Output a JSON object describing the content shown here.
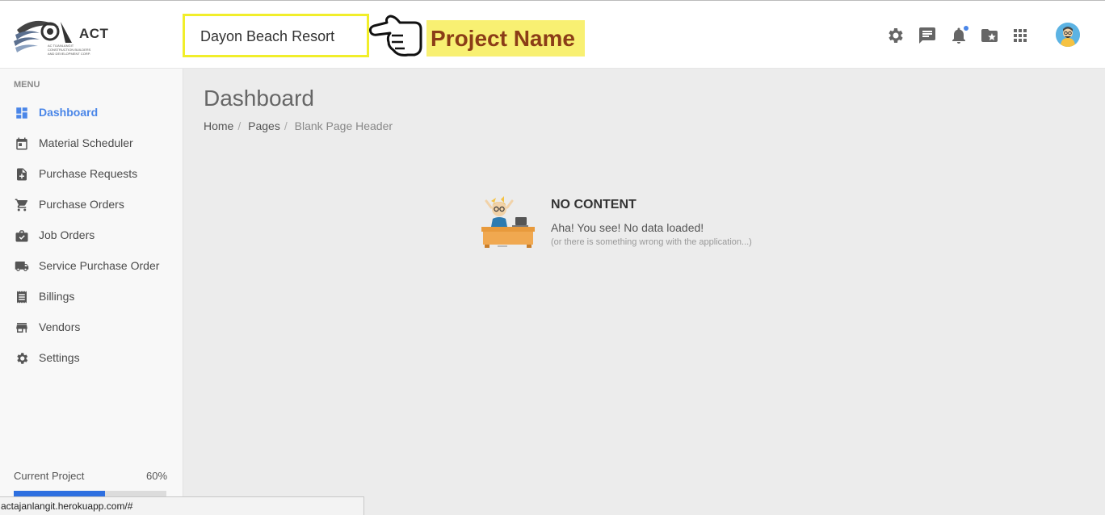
{
  "header": {
    "logo_text": "ACT",
    "logo_subtext": "AC TIJANLANGIT CONSTRUCTION BUILDERS AND DEVELOPMENT CORP.",
    "project_name": "Dayon Beach Resort",
    "annotation_label": "Project Name",
    "icons": [
      "gear-icon",
      "chat-icon",
      "bell-icon",
      "folder-star-icon",
      "apps-grid-icon"
    ],
    "notification_dot_color": "#4a86e8"
  },
  "sidebar": {
    "menu_label": "MENU",
    "items": [
      {
        "label": "Dashboard",
        "icon": "dashboard-icon",
        "active": true
      },
      {
        "label": "Material Scheduler",
        "icon": "calendar-icon",
        "active": false
      },
      {
        "label": "Purchase Requests",
        "icon": "note-add-icon",
        "active": false
      },
      {
        "label": "Purchase Orders",
        "icon": "cart-icon",
        "active": false
      },
      {
        "label": "Job Orders",
        "icon": "briefcase-check-icon",
        "active": false
      },
      {
        "label": "Service Purchase Order",
        "icon": "truck-icon",
        "active": false
      },
      {
        "label": "Billings",
        "icon": "receipt-icon",
        "active": false
      },
      {
        "label": "Vendors",
        "icon": "store-icon",
        "active": false
      },
      {
        "label": "Settings",
        "icon": "gear-icon",
        "active": false
      }
    ],
    "current_project_label": "Current Project",
    "current_project_percent": "60%",
    "current_project_progress": 0.6
  },
  "main": {
    "page_title": "Dashboard",
    "breadcrumb": [
      "Home",
      "Pages",
      "Blank Page Header"
    ],
    "no_content_title": "NO CONTENT",
    "no_content_text": "Aha! You see! No data loaded!",
    "no_content_subtext": "(or there is something wrong with the application...)"
  },
  "statusbar": {
    "url": "actajanlangit.herokuapp.com/#"
  },
  "colors": {
    "accent": "#4a86e8",
    "progress": "#2d6fe0",
    "annotation_bg": "#f8f072",
    "annotation_text": "#8b3d17",
    "project_box_border": "#f1ee2a"
  }
}
